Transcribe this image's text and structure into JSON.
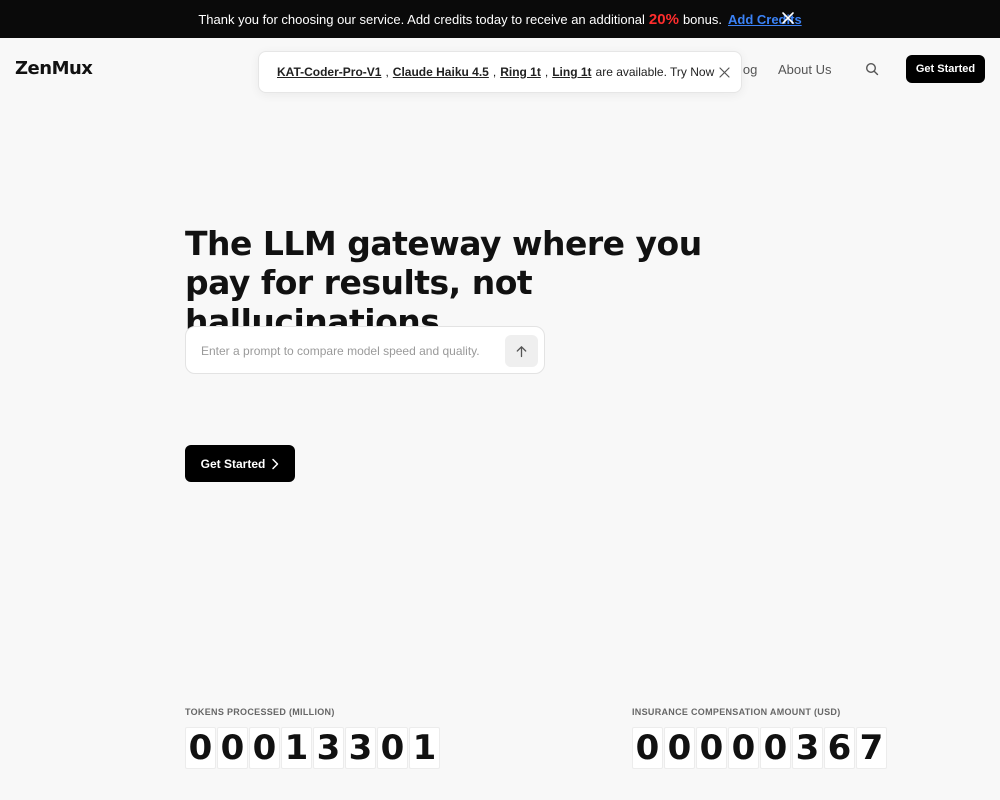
{
  "promo": {
    "text_before": "Thank you for choosing our service. Add credits today to receive an additional",
    "percent": "20%",
    "text_after": "bonus.",
    "link": "Add Credits"
  },
  "header": {
    "logo": "ZenMux",
    "nav": {
      "blog": "log",
      "about": "About Us"
    },
    "cta": "Get Started"
  },
  "announcement": {
    "models": [
      "KAT-Coder-Pro-V1",
      "Claude Haiku 4.5",
      "Ring 1t",
      "Ling 1t"
    ],
    "separator": ",",
    "tail": "are available. Try Now"
  },
  "hero": {
    "title_line1": "The LLM gateway where you",
    "title_line2": "pay for results, not hallucinations.",
    "prompt_placeholder": "Enter a prompt to compare model speed and quality.",
    "cta": "Get Started"
  },
  "stats": {
    "tokens": {
      "label": "TOKENS PROCESSED (MILLION)",
      "digits": [
        "0",
        "0",
        "0",
        "1",
        "3",
        "3",
        "0",
        "1"
      ]
    },
    "insurance": {
      "label": "INSURANCE COMPENSATION AMOUNT (USD)",
      "digits": [
        "0",
        "0",
        "0",
        "0",
        "0",
        "3",
        "6",
        "7"
      ]
    }
  },
  "colors": {
    "promo_bg": "#0a0a0a",
    "percent": "#ff2d2d",
    "link": "#3b82f6",
    "page_bg": "#f8f8f8",
    "button_bg": "#000000"
  },
  "icons": [
    "close-icon",
    "search-icon",
    "arrow-up-icon",
    "chevron-right-icon"
  ]
}
